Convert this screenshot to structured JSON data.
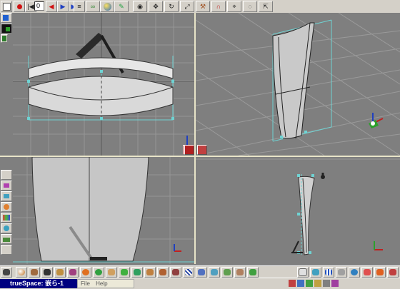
{
  "app": {
    "title": "trueSpace: 嵌ら-1",
    "frame_number": "0"
  },
  "menu": {
    "items": [
      "File",
      "Help"
    ]
  },
  "toolbar": {
    "icons": [
      "white-square-icon",
      "record-icon",
      "rewind-icon",
      "step-back-icon",
      "play-icon",
      "fast-forward-icon",
      "stop-icon",
      "record-end-icon",
      "list-icon",
      "chain-link-icon",
      "globe-icon",
      "paint-icon",
      "eye-icon",
      "object-move-icon",
      "rotate-icon",
      "scale-icon",
      "hammer-icon",
      "magnet-icon",
      "pin-icon",
      "lasso-icon",
      "select-icon"
    ]
  },
  "colors": {
    "viewport_bg": "#7f7f7f",
    "grid": "#9a9a9a",
    "cyan_guide": "#6fd3d3",
    "divider": "#e8e4c8",
    "toolbar_bg": "#d4d0c8",
    "titlebar": "#000080"
  },
  "viewports": [
    {
      "name": "front-view"
    },
    {
      "name": "perspective-view"
    },
    {
      "name": "side-view"
    },
    {
      "name": "top-view"
    }
  ]
}
